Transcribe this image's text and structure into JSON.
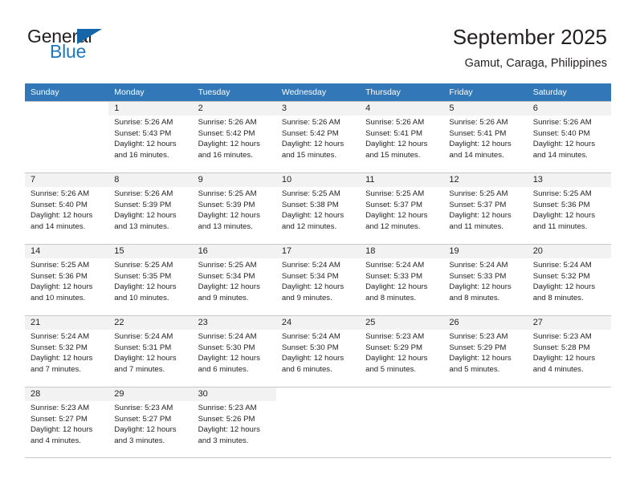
{
  "brand": {
    "name_part1": "General",
    "name_part2": "Blue",
    "accent_color": "#1566a8",
    "blue_text_color": "#1f77bd"
  },
  "header": {
    "title": "September 2025",
    "subtitle": "Gamut, Caraga, Philippines"
  },
  "theme": {
    "header_row_bg": "#3277b7",
    "daynum_bg": "#f2f2f2",
    "grid_line": "#c8c8c8",
    "text": "#231f20"
  },
  "weekdays": [
    "Sunday",
    "Monday",
    "Tuesday",
    "Wednesday",
    "Thursday",
    "Friday",
    "Saturday"
  ],
  "weeks": [
    [
      {
        "day": "",
        "empty": true,
        "sunrise": "",
        "sunset": "",
        "daylight1": "",
        "daylight2": ""
      },
      {
        "day": "1",
        "sunrise": "Sunrise: 5:26 AM",
        "sunset": "Sunset: 5:43 PM",
        "daylight1": "Daylight: 12 hours",
        "daylight2": "and 16 minutes."
      },
      {
        "day": "2",
        "sunrise": "Sunrise: 5:26 AM",
        "sunset": "Sunset: 5:42 PM",
        "daylight1": "Daylight: 12 hours",
        "daylight2": "and 16 minutes."
      },
      {
        "day": "3",
        "sunrise": "Sunrise: 5:26 AM",
        "sunset": "Sunset: 5:42 PM",
        "daylight1": "Daylight: 12 hours",
        "daylight2": "and 15 minutes."
      },
      {
        "day": "4",
        "sunrise": "Sunrise: 5:26 AM",
        "sunset": "Sunset: 5:41 PM",
        "daylight1": "Daylight: 12 hours",
        "daylight2": "and 15 minutes."
      },
      {
        "day": "5",
        "sunrise": "Sunrise: 5:26 AM",
        "sunset": "Sunset: 5:41 PM",
        "daylight1": "Daylight: 12 hours",
        "daylight2": "and 14 minutes."
      },
      {
        "day": "6",
        "sunrise": "Sunrise: 5:26 AM",
        "sunset": "Sunset: 5:40 PM",
        "daylight1": "Daylight: 12 hours",
        "daylight2": "and 14 minutes."
      }
    ],
    [
      {
        "day": "7",
        "sunrise": "Sunrise: 5:26 AM",
        "sunset": "Sunset: 5:40 PM",
        "daylight1": "Daylight: 12 hours",
        "daylight2": "and 14 minutes."
      },
      {
        "day": "8",
        "sunrise": "Sunrise: 5:26 AM",
        "sunset": "Sunset: 5:39 PM",
        "daylight1": "Daylight: 12 hours",
        "daylight2": "and 13 minutes."
      },
      {
        "day": "9",
        "sunrise": "Sunrise: 5:25 AM",
        "sunset": "Sunset: 5:39 PM",
        "daylight1": "Daylight: 12 hours",
        "daylight2": "and 13 minutes."
      },
      {
        "day": "10",
        "sunrise": "Sunrise: 5:25 AM",
        "sunset": "Sunset: 5:38 PM",
        "daylight1": "Daylight: 12 hours",
        "daylight2": "and 12 minutes."
      },
      {
        "day": "11",
        "sunrise": "Sunrise: 5:25 AM",
        "sunset": "Sunset: 5:37 PM",
        "daylight1": "Daylight: 12 hours",
        "daylight2": "and 12 minutes."
      },
      {
        "day": "12",
        "sunrise": "Sunrise: 5:25 AM",
        "sunset": "Sunset: 5:37 PM",
        "daylight1": "Daylight: 12 hours",
        "daylight2": "and 11 minutes."
      },
      {
        "day": "13",
        "sunrise": "Sunrise: 5:25 AM",
        "sunset": "Sunset: 5:36 PM",
        "daylight1": "Daylight: 12 hours",
        "daylight2": "and 11 minutes."
      }
    ],
    [
      {
        "day": "14",
        "sunrise": "Sunrise: 5:25 AM",
        "sunset": "Sunset: 5:36 PM",
        "daylight1": "Daylight: 12 hours",
        "daylight2": "and 10 minutes."
      },
      {
        "day": "15",
        "sunrise": "Sunrise: 5:25 AM",
        "sunset": "Sunset: 5:35 PM",
        "daylight1": "Daylight: 12 hours",
        "daylight2": "and 10 minutes."
      },
      {
        "day": "16",
        "sunrise": "Sunrise: 5:25 AM",
        "sunset": "Sunset: 5:34 PM",
        "daylight1": "Daylight: 12 hours",
        "daylight2": "and 9 minutes."
      },
      {
        "day": "17",
        "sunrise": "Sunrise: 5:24 AM",
        "sunset": "Sunset: 5:34 PM",
        "daylight1": "Daylight: 12 hours",
        "daylight2": "and 9 minutes."
      },
      {
        "day": "18",
        "sunrise": "Sunrise: 5:24 AM",
        "sunset": "Sunset: 5:33 PM",
        "daylight1": "Daylight: 12 hours",
        "daylight2": "and 8 minutes."
      },
      {
        "day": "19",
        "sunrise": "Sunrise: 5:24 AM",
        "sunset": "Sunset: 5:33 PM",
        "daylight1": "Daylight: 12 hours",
        "daylight2": "and 8 minutes."
      },
      {
        "day": "20",
        "sunrise": "Sunrise: 5:24 AM",
        "sunset": "Sunset: 5:32 PM",
        "daylight1": "Daylight: 12 hours",
        "daylight2": "and 8 minutes."
      }
    ],
    [
      {
        "day": "21",
        "sunrise": "Sunrise: 5:24 AM",
        "sunset": "Sunset: 5:32 PM",
        "daylight1": "Daylight: 12 hours",
        "daylight2": "and 7 minutes."
      },
      {
        "day": "22",
        "sunrise": "Sunrise: 5:24 AM",
        "sunset": "Sunset: 5:31 PM",
        "daylight1": "Daylight: 12 hours",
        "daylight2": "and 7 minutes."
      },
      {
        "day": "23",
        "sunrise": "Sunrise: 5:24 AM",
        "sunset": "Sunset: 5:30 PM",
        "daylight1": "Daylight: 12 hours",
        "daylight2": "and 6 minutes."
      },
      {
        "day": "24",
        "sunrise": "Sunrise: 5:24 AM",
        "sunset": "Sunset: 5:30 PM",
        "daylight1": "Daylight: 12 hours",
        "daylight2": "and 6 minutes."
      },
      {
        "day": "25",
        "sunrise": "Sunrise: 5:23 AM",
        "sunset": "Sunset: 5:29 PM",
        "daylight1": "Daylight: 12 hours",
        "daylight2": "and 5 minutes."
      },
      {
        "day": "26",
        "sunrise": "Sunrise: 5:23 AM",
        "sunset": "Sunset: 5:29 PM",
        "daylight1": "Daylight: 12 hours",
        "daylight2": "and 5 minutes."
      },
      {
        "day": "27",
        "sunrise": "Sunrise: 5:23 AM",
        "sunset": "Sunset: 5:28 PM",
        "daylight1": "Daylight: 12 hours",
        "daylight2": "and 4 minutes."
      }
    ],
    [
      {
        "day": "28",
        "sunrise": "Sunrise: 5:23 AM",
        "sunset": "Sunset: 5:27 PM",
        "daylight1": "Daylight: 12 hours",
        "daylight2": "and 4 minutes."
      },
      {
        "day": "29",
        "sunrise": "Sunrise: 5:23 AM",
        "sunset": "Sunset: 5:27 PM",
        "daylight1": "Daylight: 12 hours",
        "daylight2": "and 3 minutes."
      },
      {
        "day": "30",
        "sunrise": "Sunrise: 5:23 AM",
        "sunset": "Sunset: 5:26 PM",
        "daylight1": "Daylight: 12 hours",
        "daylight2": "and 3 minutes."
      },
      {
        "day": "",
        "empty": true,
        "sunrise": "",
        "sunset": "",
        "daylight1": "",
        "daylight2": ""
      },
      {
        "day": "",
        "empty": true,
        "sunrise": "",
        "sunset": "",
        "daylight1": "",
        "daylight2": ""
      },
      {
        "day": "",
        "empty": true,
        "sunrise": "",
        "sunset": "",
        "daylight1": "",
        "daylight2": ""
      },
      {
        "day": "",
        "empty": true,
        "sunrise": "",
        "sunset": "",
        "daylight1": "",
        "daylight2": ""
      }
    ]
  ]
}
